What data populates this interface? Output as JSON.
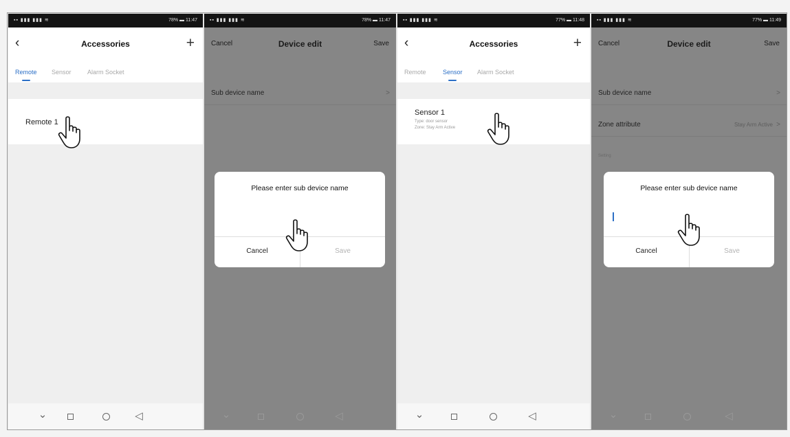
{
  "status": {
    "signal": "▪▪ ▮▮▮ ▮▮▮ ≋",
    "s1": "78% ▬ 11:47",
    "s2": "78% ▬ 11:47",
    "s3": "77% ▬ 11:48",
    "s4": "77% ▬ 11:49"
  },
  "accessories": {
    "title": "Accessories",
    "back_icon": "‹",
    "add_icon": "+",
    "tabs": [
      "Remote",
      "Sensor",
      "Alarm Socket"
    ]
  },
  "screen1": {
    "item_label": "Remote 1"
  },
  "device_edit": {
    "title": "Device edit",
    "cancel": "Cancel",
    "save": "Save",
    "sub_device_name": "Sub device name",
    "zone_attribute": "Zone attribute",
    "zone_value": "Stay Arm Active",
    "setting_label": "Setting",
    "chevron": ">"
  },
  "screen3": {
    "sensor_name": "Sensor 1",
    "type_line": "Type:  door sensor",
    "zone_line": "Zone:  Stay Arm Active"
  },
  "dialog": {
    "title": "Please enter sub device name",
    "cancel": "Cancel",
    "save": "Save"
  },
  "navbar": {
    "back": "◁",
    "down": "⌄"
  },
  "colors": {
    "accent": "#2b6fc6",
    "overlay": "#868686"
  }
}
